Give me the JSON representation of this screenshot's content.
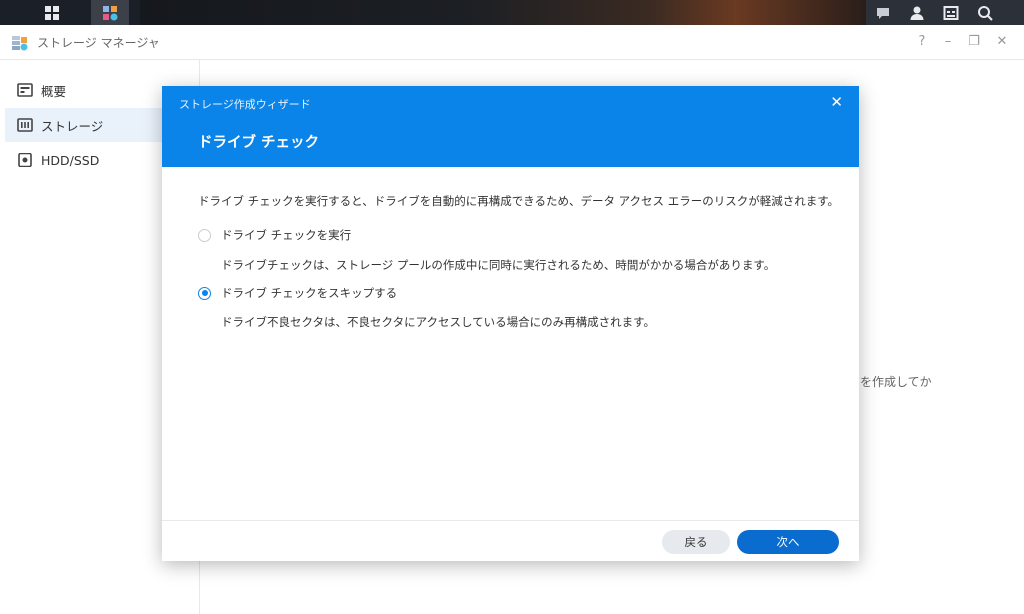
{
  "window": {
    "title": "ストレージ マネージャ",
    "help": "?",
    "minimize": "–",
    "restore": "❐",
    "close": "✕"
  },
  "sidebar": {
    "items": [
      {
        "label": "概要"
      },
      {
        "label": "ストレージ"
      },
      {
        "label": "HDD/SSD"
      }
    ]
  },
  "background": {
    "hint": "を作成してか"
  },
  "dialog": {
    "wizard_title": "ストレージ作成ウィザード",
    "close": "✕",
    "title": "ドライブ チェック",
    "description": "ドライブ チェックを実行すると、ドライブを自動的に再構成できるため、データ アクセス エラーのリスクが軽減されます。",
    "options": [
      {
        "label": "ドライブ チェックを実行",
        "detail": "ドライブチェックは、ストレージ プールの作成中に同時に実行されるため、時間がかかる場合があります。",
        "selected": false
      },
      {
        "label": "ドライブ チェックをスキップする",
        "detail": "ドライブ不良セクタは、不良セクタにアクセスしている場合にのみ再構成されます。",
        "selected": true
      }
    ],
    "back_label": "戻る",
    "next_label": "次へ"
  },
  "colors": {
    "accent": "#0a84e8",
    "primary_button": "#0a6ccf"
  }
}
